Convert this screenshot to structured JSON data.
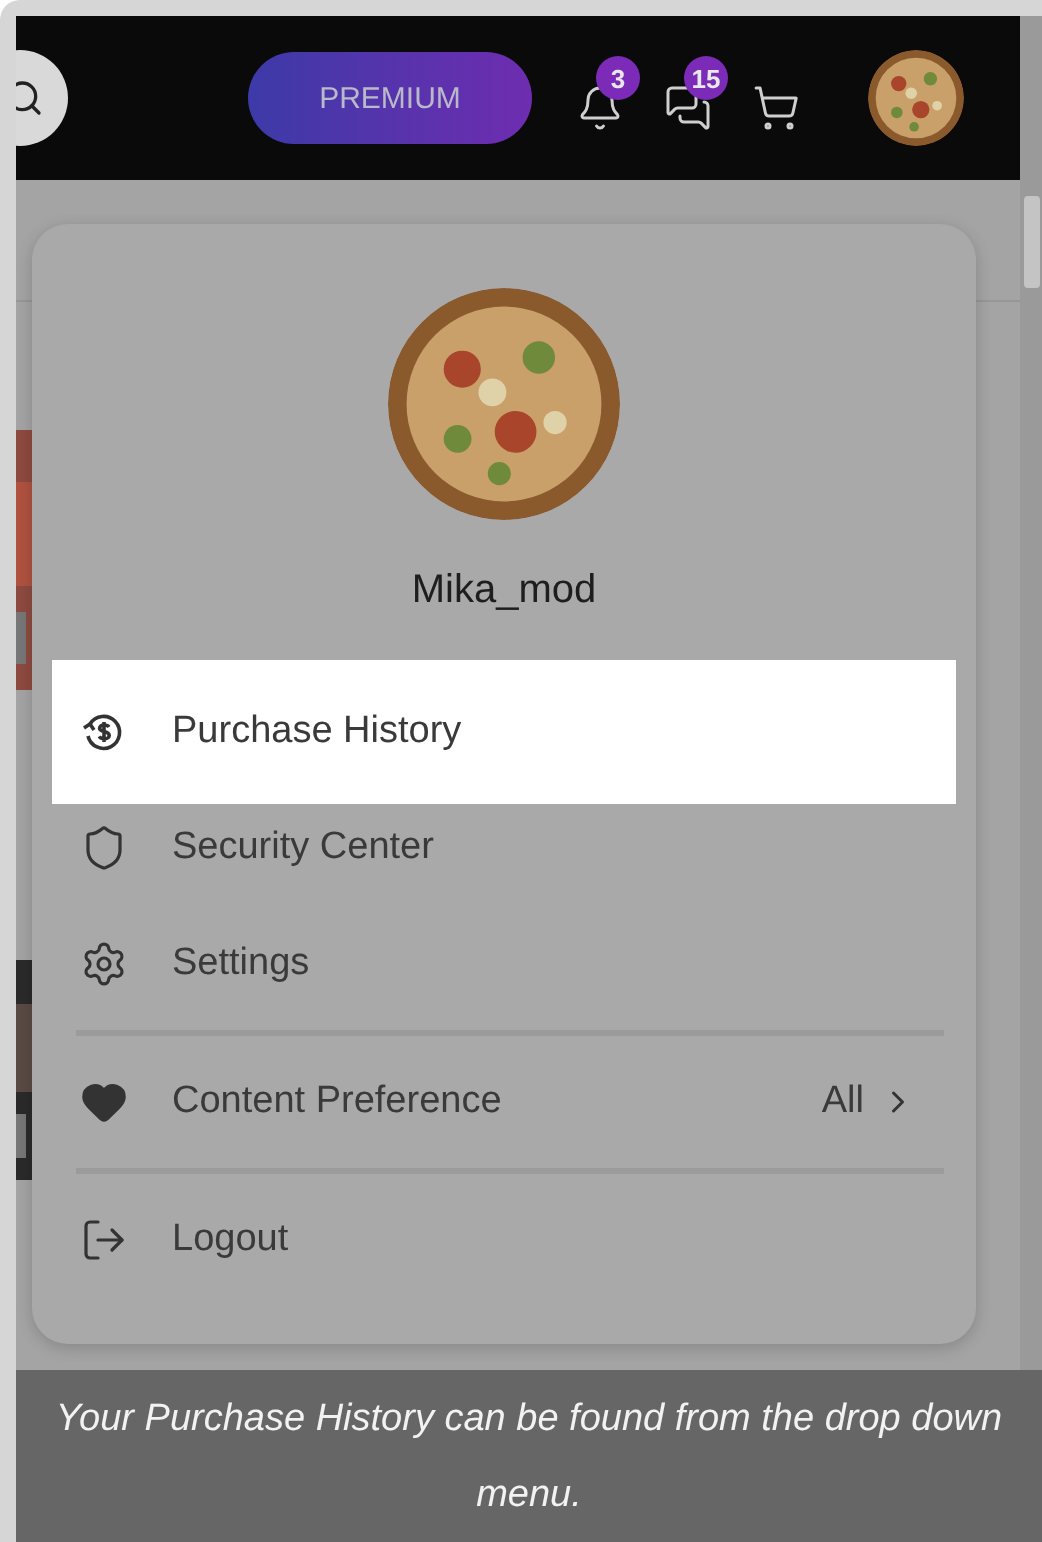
{
  "header": {
    "premium_label": "PREMIUM",
    "notifications_count": "3",
    "messages_count": "15"
  },
  "menu": {
    "username": "Mika_mod",
    "groups": [
      [
        {
          "kind": "history",
          "label": "Purchase History",
          "selected": true
        },
        {
          "kind": "security",
          "label": "Security Center",
          "selected": false
        },
        {
          "kind": "settings",
          "label": "Settings",
          "selected": false
        }
      ],
      [
        {
          "kind": "preference",
          "label": "Content Preference",
          "value": "All",
          "selected": false
        }
      ],
      [
        {
          "kind": "logout",
          "label": "Logout",
          "selected": false
        }
      ]
    ]
  },
  "caption": "Your Purchase History can be found from the drop down menu."
}
